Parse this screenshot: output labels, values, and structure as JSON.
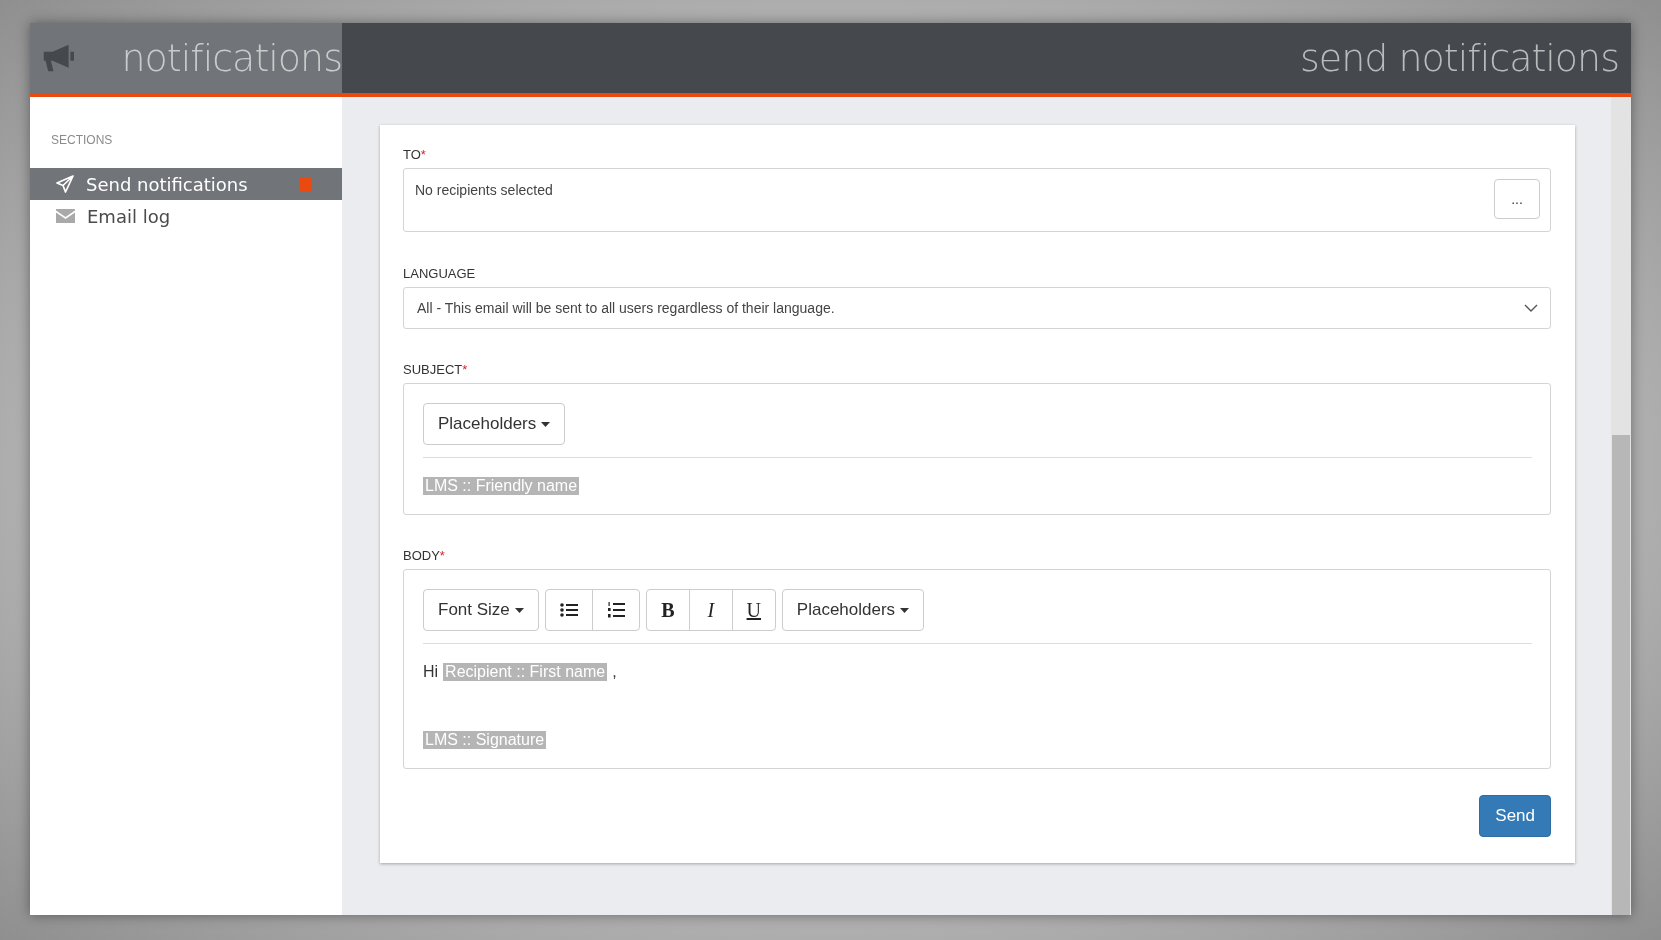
{
  "header": {
    "app_title": "notifications",
    "page_title": "send notifications"
  },
  "sidebar": {
    "heading": "SECTIONS",
    "items": [
      {
        "kind": "send",
        "label": "Send notifications",
        "selected": true
      },
      {
        "kind": "mail",
        "label": "Email log",
        "selected": false
      }
    ]
  },
  "form": {
    "to": {
      "label": "TO",
      "required_mark": "*",
      "value": "No recipients selected",
      "button": "..."
    },
    "language": {
      "label": "LANGUAGE",
      "value": "All - This email will be sent to all users regardless of their language."
    },
    "subject": {
      "label": "SUBJECT",
      "required_mark": "*",
      "toolbar": [
        {
          "kind": "dropdown",
          "label": "Placeholders"
        }
      ],
      "tags": [
        "LMS :: Friendly name"
      ]
    },
    "body": {
      "label": "BODY",
      "required_mark": "*",
      "toolbar": [
        {
          "kind": "dropdown",
          "label": "Font Size"
        },
        {
          "kind": "group",
          "buttons": [
            {
              "kind": "bullet_list"
            },
            {
              "kind": "numbered_list"
            }
          ]
        },
        {
          "kind": "group",
          "buttons": [
            {
              "kind": "bold",
              "label": "B"
            },
            {
              "kind": "italic",
              "label": "I"
            },
            {
              "kind": "underline",
              "label": "U"
            }
          ]
        },
        {
          "kind": "dropdown",
          "label": "Placeholders"
        }
      ],
      "lines": [
        [
          {
            "kind": "text",
            "text": "Hi"
          },
          {
            "kind": "tag",
            "text": "Recipient :: First name"
          },
          {
            "kind": "text",
            "text": ","
          }
        ],
        [
          {
            "kind": "tag",
            "text": "LMS :: Signature"
          }
        ]
      ]
    },
    "submit": "Send"
  }
}
